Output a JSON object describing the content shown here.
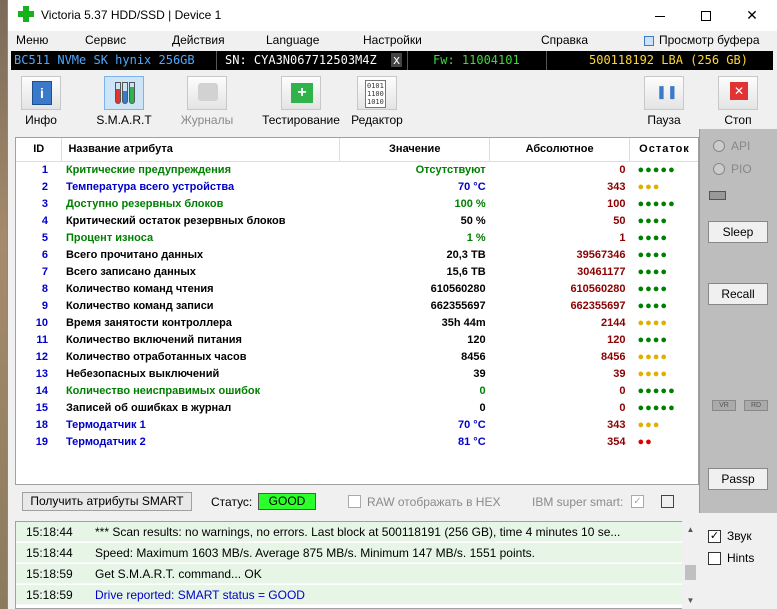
{
  "window": {
    "title": "Victoria 5.37 HDD/SSD | Device 1"
  },
  "menu": {
    "items": [
      "Меню",
      "Сервис",
      "Действия",
      "Language",
      "Настройки",
      "Справка"
    ],
    "buffer_view": "Просмотр буфера"
  },
  "device": {
    "model": "BC511 NVMe SK hynix 256GB",
    "serial": "SN: CYA3N067712503M4Z",
    "x": "x",
    "firmware": "Fw: 11004101",
    "lba": "500118192 LBA (256 GB)"
  },
  "toolbar": {
    "info": "Инфо",
    "smart": "S.M.A.R.T",
    "journals": "Журналы",
    "testing": "Тестирование",
    "editor": "Редактор",
    "pause": "Пауза",
    "stop": "Стоп"
  },
  "table": {
    "headers": [
      "ID",
      "Название атрибута",
      "Значение",
      "Абсолютное",
      "Остаток"
    ],
    "rows": [
      {
        "id": "1",
        "name": "Критические предупреждения",
        "value": "Отсутствуют",
        "absolute": "0",
        "dots": "●●●●●",
        "dotcolor": "g",
        "color": "green"
      },
      {
        "id": "2",
        "name": "Температура всего устройства",
        "value": "70 °C",
        "absolute": "343",
        "dots": "●●●",
        "dotcolor": "y",
        "color": "blue"
      },
      {
        "id": "3",
        "name": "Доступно резервных блоков",
        "value": "100 %",
        "absolute": "100",
        "dots": "●●●●●",
        "dotcolor": "g",
        "color": "green"
      },
      {
        "id": "4",
        "name": "Критический остаток резервных блоков",
        "value": "50 %",
        "absolute": "50",
        "dots": "●●●●",
        "dotcolor": "g",
        "color": "black"
      },
      {
        "id": "5",
        "name": "Процент износа",
        "value": "1 %",
        "absolute": "1",
        "dots": "●●●●",
        "dotcolor": "g",
        "color": "green"
      },
      {
        "id": "6",
        "name": "Всего прочитано данных",
        "value": "20,3 TB",
        "absolute": "39567346",
        "dots": "●●●●",
        "dotcolor": "g",
        "color": "black"
      },
      {
        "id": "7",
        "name": "Всего записано данных",
        "value": "15,6 TB",
        "absolute": "30461177",
        "dots": "●●●●",
        "dotcolor": "g",
        "color": "black"
      },
      {
        "id": "8",
        "name": "Количество команд чтения",
        "value": "610560280",
        "absolute": "610560280",
        "dots": "●●●●",
        "dotcolor": "g",
        "color": "black"
      },
      {
        "id": "9",
        "name": "Количество команд записи",
        "value": "662355697",
        "absolute": "662355697",
        "dots": "●●●●",
        "dotcolor": "g",
        "color": "black"
      },
      {
        "id": "10",
        "name": "Время занятости контроллера",
        "value": "35h 44m",
        "absolute": "2144",
        "dots": "●●●●",
        "dotcolor": "y",
        "color": "black"
      },
      {
        "id": "11",
        "name": "Количество включений питания",
        "value": "120",
        "absolute": "120",
        "dots": "●●●●",
        "dotcolor": "g",
        "color": "black"
      },
      {
        "id": "12",
        "name": "Количество отработанных часов",
        "value": "8456",
        "absolute": "8456",
        "dots": "●●●●",
        "dotcolor": "y",
        "color": "black"
      },
      {
        "id": "13",
        "name": "Небезопасных выключений",
        "value": "39",
        "absolute": "39",
        "dots": "●●●●",
        "dotcolor": "y",
        "color": "black"
      },
      {
        "id": "14",
        "name": "Количество неисправимых ошибок",
        "value": "0",
        "absolute": "0",
        "dots": "●●●●●",
        "dotcolor": "g",
        "color": "green"
      },
      {
        "id": "15",
        "name": "Записей об ошибках в журнал",
        "value": "0",
        "absolute": "0",
        "dots": "●●●●●",
        "dotcolor": "g",
        "color": "black"
      },
      {
        "id": "18",
        "name": "Термодатчик 1",
        "value": "70 °C",
        "absolute": "343",
        "dots": "●●●",
        "dotcolor": "y",
        "color": "blue"
      },
      {
        "id": "19",
        "name": "Термодатчик 2",
        "value": "81 °C",
        "absolute": "354",
        "dots": "●●",
        "dotcolor": "r",
        "color": "blue"
      }
    ]
  },
  "status": {
    "get_smart_button": "Получить атрибуты SMART",
    "status_label": "Статус:",
    "status_value": "GOOD",
    "raw_hex": "RAW отображать в HEX",
    "ibm_super_smart": "IBM super smart:",
    "ibm_check": "✓"
  },
  "right_panel": {
    "api": "API",
    "pio": "PIO",
    "sleep": "Sleep",
    "recall": "Recall",
    "vr": "VR",
    "rd": "RD",
    "passp": "Passp"
  },
  "log": {
    "lines": [
      {
        "time": "15:18:44",
        "msg": "*** Scan results: no warnings, no errors. Last block at 500118191 (256 GB), time 4 minutes 10 se..."
      },
      {
        "time": "15:18:44",
        "msg": "Speed: Maximum 1603 MB/s. Average 875 MB/s. Minimum 147 MB/s. 1551 points."
      },
      {
        "time": "15:18:59",
        "msg": "Get S.M.A.R.T. command... OK"
      },
      {
        "time": "15:18:59",
        "msg": "Drive reported: SMART status = GOOD"
      }
    ],
    "sound": "Звук",
    "hints": "Hints",
    "sound_check": "✓"
  },
  "colors": {
    "status_good": "#2cff2c",
    "value_blue": "#0000c8",
    "value_green": "#008000",
    "absolute_red": "#8b0000"
  },
  "icons": [
    "victoria-app-icon",
    "info-icon",
    "smart-icon",
    "journal-icon",
    "test-icon",
    "editor-icon",
    "pause-icon",
    "stop-icon",
    "buffer-icon"
  ]
}
